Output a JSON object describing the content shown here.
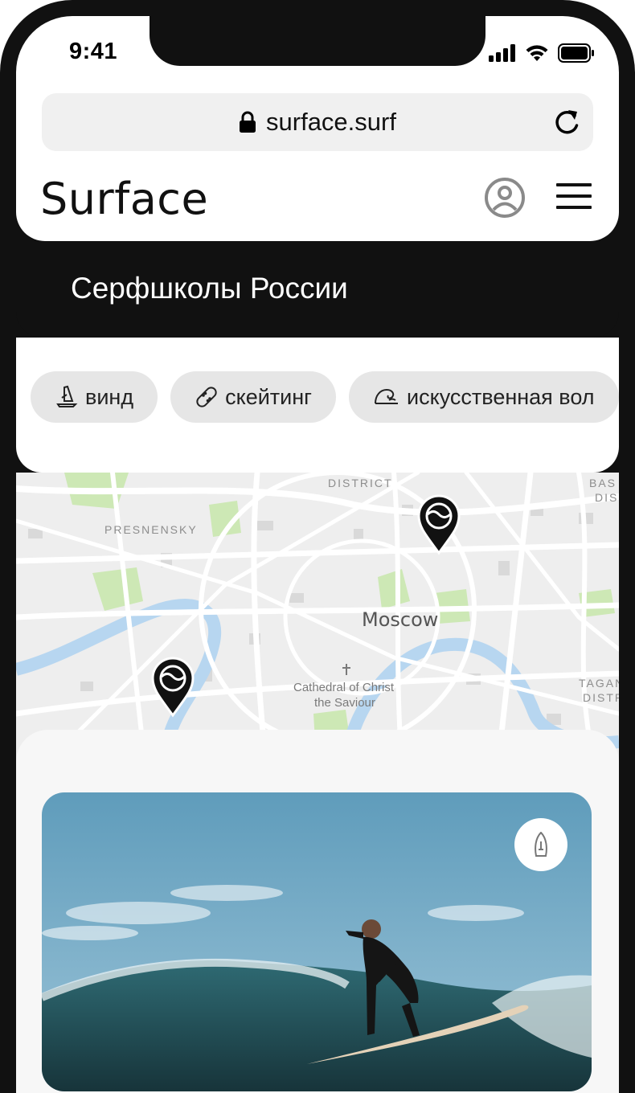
{
  "status_bar": {
    "time": "9:41"
  },
  "browser": {
    "url": "surface.surf"
  },
  "header": {
    "logo": "Surface"
  },
  "hero": {
    "title": "Серфшколы России"
  },
  "filters": [
    {
      "label": "винд",
      "icon": "windsurf-icon"
    },
    {
      "label": "скейтинг",
      "icon": "skateboard-icon"
    },
    {
      "label": "искусственная вол",
      "icon": "wave-icon"
    }
  ],
  "map": {
    "labels": {
      "district_top": "DISTRICT",
      "presnensky": "PRESNENSKY",
      "moscow": "Moscow",
      "cathedral_line1": "Cathedral of Christ",
      "cathedral_line2": "the Saviour",
      "basm_1": "BAS",
      "basm_2": "DIS",
      "tagan_1": "TAGAN",
      "tagan_2": "DISTR"
    },
    "colors": {
      "land": "#eeeeee",
      "road": "#ffffff",
      "park": "#cde8b5",
      "water": "#b7d6f0",
      "block": "#d9d9d9"
    }
  },
  "card": {
    "badge_icon": "surfboard-icon"
  }
}
